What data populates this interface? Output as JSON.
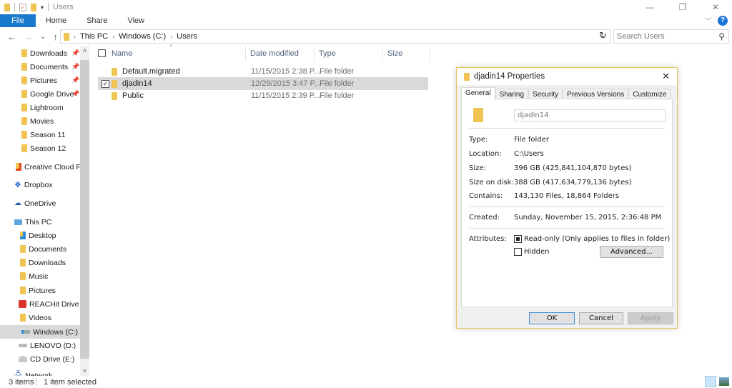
{
  "window": {
    "title": "Users",
    "controls": {
      "minimize": "—",
      "maximize": "❐",
      "close": "✕"
    }
  },
  "ribbon": {
    "tabs": [
      "File",
      "Home",
      "Share",
      "View"
    ],
    "expand_icon": "chevron-down-icon",
    "help": "?"
  },
  "address": {
    "back": "←",
    "forward": "→",
    "recent": "⌄",
    "up": "↑",
    "breadcrumb": [
      "This PC",
      "Windows (C:)",
      "Users"
    ],
    "search_placeholder": "Search Users"
  },
  "sidebar": {
    "items": [
      {
        "label": "Downloads",
        "pinned": true
      },
      {
        "label": "Documents",
        "pinned": true
      },
      {
        "label": "Pictures",
        "pinned": true
      },
      {
        "label": "Google Drive",
        "pinned": true
      },
      {
        "label": "Lightroom"
      },
      {
        "label": "Movies"
      },
      {
        "label": "Season 11"
      },
      {
        "label": "Season 12"
      },
      {
        "label": "Creative Cloud Files"
      },
      {
        "label": "Dropbox"
      },
      {
        "label": "OneDrive"
      },
      {
        "label": "This PC"
      },
      {
        "label": "Desktop"
      },
      {
        "label": "Documents"
      },
      {
        "label": "Downloads"
      },
      {
        "label": "Music"
      },
      {
        "label": "Pictures"
      },
      {
        "label": "REACHit Drive"
      },
      {
        "label": "Videos"
      },
      {
        "label": "Windows (C:)",
        "selected": true
      },
      {
        "label": "LENOVO (D:)"
      },
      {
        "label": "CD Drive (E:)"
      },
      {
        "label": "Network"
      }
    ]
  },
  "filelist": {
    "columns": [
      "Name",
      "Date modified",
      "Type",
      "Size"
    ],
    "rows": [
      {
        "name": "Default.migrated",
        "date": "11/15/2015 2:38 P...",
        "type": "File folder",
        "selected": false
      },
      {
        "name": "djadin14",
        "date": "12/29/2015 3:47 P...",
        "type": "File folder",
        "selected": true
      },
      {
        "name": "Public",
        "date": "11/15/2015 2:39 P...",
        "type": "File folder",
        "selected": false
      }
    ]
  },
  "status": {
    "count": "3 items",
    "selected": "1 item selected"
  },
  "dialog": {
    "title": "djadin14 Properties",
    "tabs": [
      "General",
      "Sharing",
      "Security",
      "Previous Versions",
      "Customize"
    ],
    "active_tab": "General",
    "name": "djadin14",
    "fields": [
      {
        "label": "Type:",
        "value": "File folder"
      },
      {
        "label": "Location:",
        "value": "C:\\Users"
      },
      {
        "label": "Size:",
        "value": "396 GB (425,841,104,870 bytes)"
      },
      {
        "label": "Size on disk:",
        "value": "388 GB (417,634,779,136 bytes)"
      },
      {
        "label": "Contains:",
        "value": "143,130 Files, 18,864 Folders"
      }
    ],
    "created_label": "Created:",
    "created_value": "Sunday, November 15, 2015, 2:36:48 PM",
    "attributes_label": "Attributes:",
    "readonly_label": "Read-only (Only applies to files in folder)",
    "readonly_state": "indeterminate",
    "hidden_label": "Hidden",
    "hidden_state": "unchecked",
    "advanced_label": "Advanced...",
    "ok_label": "OK",
    "cancel_label": "Cancel",
    "apply_label": "Apply"
  }
}
